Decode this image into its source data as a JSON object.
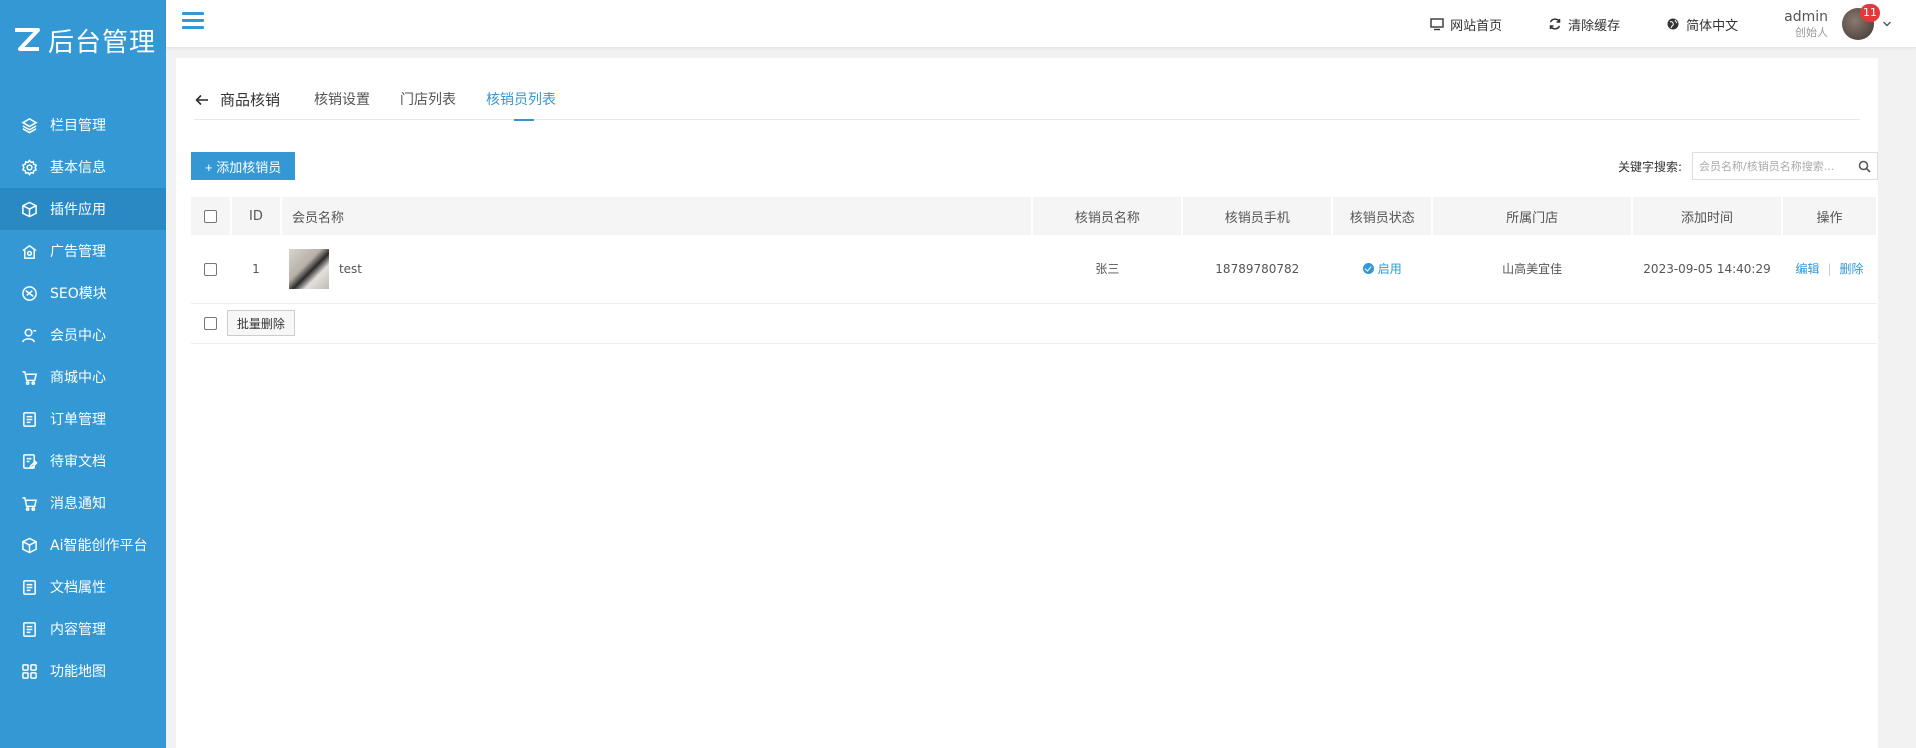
{
  "brand": {
    "logo_text": "后台管理"
  },
  "sidebar": {
    "items": [
      {
        "label": "栏目管理",
        "icon": "layers-icon"
      },
      {
        "label": "基本信息",
        "icon": "gear-icon"
      },
      {
        "label": "插件应用",
        "icon": "cube-icon",
        "active": true
      },
      {
        "label": "广告管理",
        "icon": "ad-icon"
      },
      {
        "label": "SEO模块",
        "icon": "seo-icon"
      },
      {
        "label": "会员中心",
        "icon": "user-icon"
      },
      {
        "label": "商城中心",
        "icon": "cart-icon"
      },
      {
        "label": "订单管理",
        "icon": "list-icon"
      },
      {
        "label": "待审文档",
        "icon": "edit-doc-icon"
      },
      {
        "label": "消息通知",
        "icon": "cart-icon"
      },
      {
        "label": "Ai智能创作平台",
        "icon": "cube-icon"
      },
      {
        "label": "文档属性",
        "icon": "list-icon"
      },
      {
        "label": "内容管理",
        "icon": "list-icon"
      },
      {
        "label": "功能地图",
        "icon": "grid-icon"
      }
    ]
  },
  "header": {
    "links": {
      "home": "网站首页",
      "clear_cache": "清除缓存",
      "language": "简体中文"
    },
    "user": {
      "name": "admin",
      "role": "创始人",
      "badge": "11"
    }
  },
  "tabs": {
    "back_label": "商品核销",
    "items": [
      "核销设置",
      "门店列表",
      "核销员列表"
    ],
    "active_index": 2
  },
  "toolbar": {
    "add_label": "+ 添加核销员",
    "search_label": "关键字搜索:",
    "search_placeholder": "会员名称/核销员名称搜索..."
  },
  "table": {
    "headers": [
      "ID",
      "会员名称",
      "核销员名称",
      "核销员手机",
      "核销员状态",
      "所属门店",
      "添加时间",
      "操作"
    ],
    "rows": [
      {
        "id": "1",
        "member": "test",
        "verifier_name": "张三",
        "phone": "18789780782",
        "status": "启用",
        "store": "山高美宜佳",
        "added": "2023-09-05 14:40:29",
        "edit_label": "编辑",
        "delete_label": "删除"
      }
    ],
    "bulk_delete_label": "批量删除"
  },
  "colors": {
    "accent": "#3398d4",
    "sidebar_bg": "#3398d4",
    "badge": "#e4393c"
  }
}
